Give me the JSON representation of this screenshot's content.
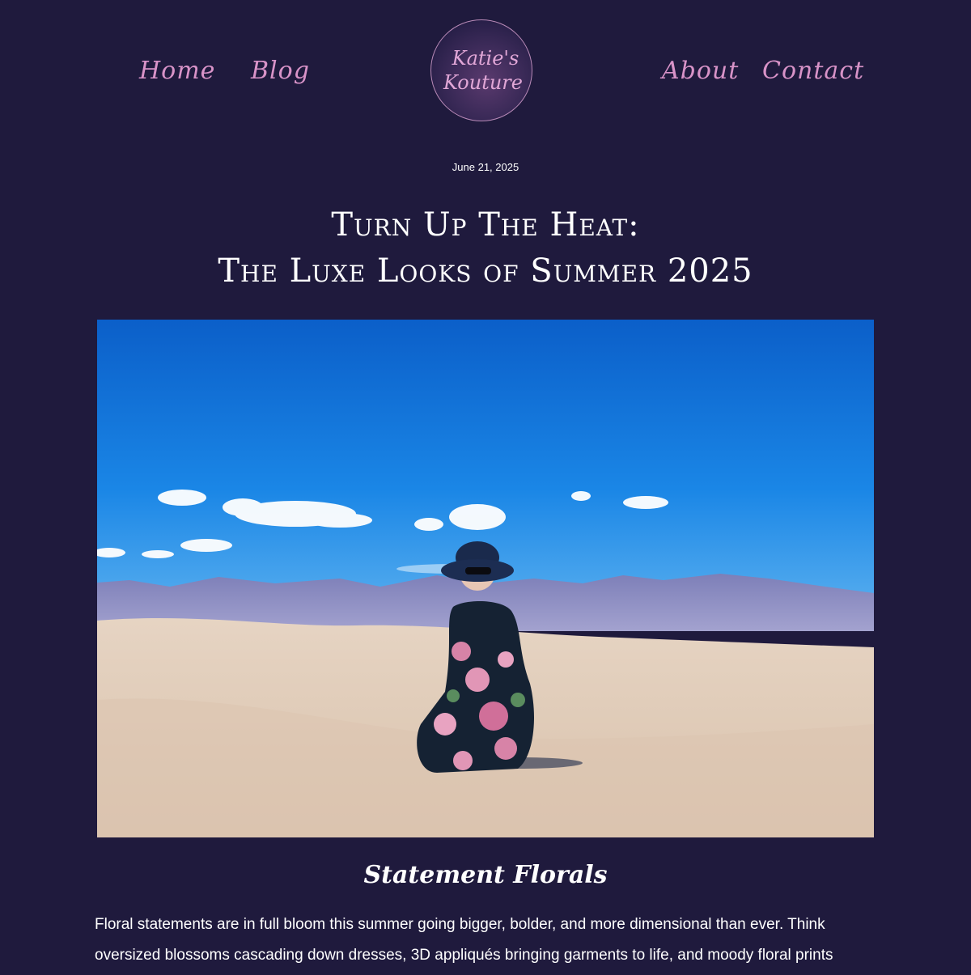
{
  "nav": {
    "home": "Home",
    "blog": "Blog",
    "about": "About",
    "contact": "Contact"
  },
  "logo": {
    "line1": "Katie's",
    "line2": "Kouture"
  },
  "post": {
    "date": "June 21, 2025",
    "title_line1": "Turn Up The Heat:",
    "title_line2": "The Luxe Looks of Summer 2025",
    "section_heading": "Statement Florals",
    "paragraph": "Floral statements are in full bloom this summer going bigger, bolder, and more dimensional than ever. Think oversized blossoms cascading down dresses, 3D appliqués bringing garments to life, and moody floral prints"
  },
  "colors": {
    "background": "#1f1a3d",
    "nav_link": "#d893c8",
    "text": "#ffffff"
  }
}
